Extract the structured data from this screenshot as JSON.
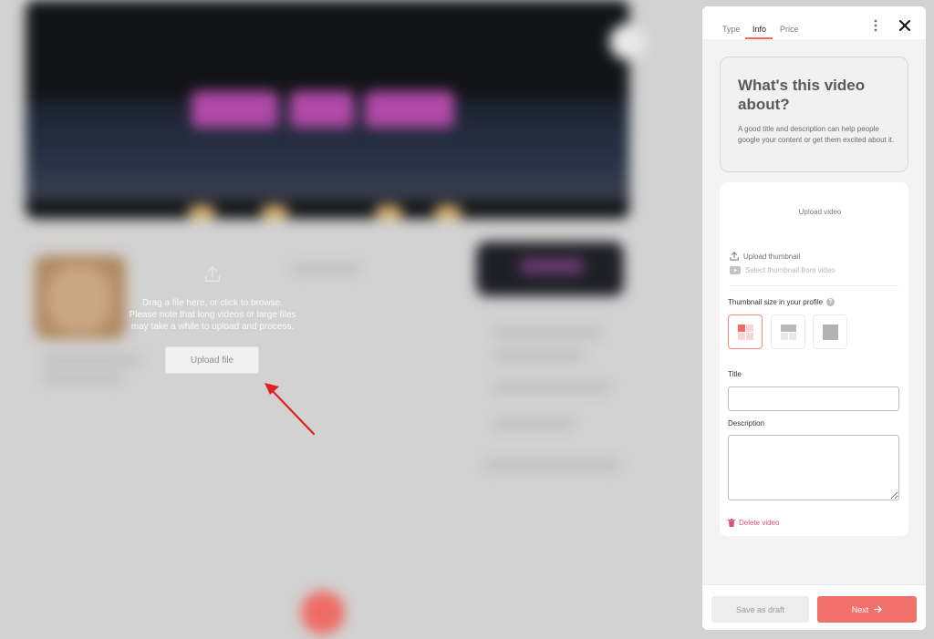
{
  "upload_area": {
    "instructions_line1": "Drag a file here, or click to browse.",
    "instructions_line2": "Please note that long videos or large files",
    "instructions_line3": "may take a while to upload and process.",
    "button_label": "Upload file"
  },
  "panel": {
    "tabs": [
      {
        "label": "Type",
        "active": false
      },
      {
        "label": "Info",
        "active": true
      },
      {
        "label": "Price",
        "active": false
      }
    ],
    "intro": {
      "title": "What's this video about?",
      "text": "A good title and description can help people google your content or get them excited about it."
    },
    "upload_video_label": "Upload video",
    "upload_thumbnail_label": "Upload thumbnail",
    "select_thumbnail_label": "Select thumbnail from video",
    "thumbnail_size_label": "Thumbnail size in your profile",
    "title_label": "Title",
    "title_value": "",
    "description_label": "Description",
    "description_value": "",
    "delete_label": "Delete video",
    "footer": {
      "draft_label": "Save as draft",
      "next_label": "Next"
    }
  },
  "colors": {
    "accent": "#f2706a",
    "delete": "#d94f76"
  },
  "icons": [
    "upload-cloud-icon",
    "more-vertical-icon",
    "close-icon",
    "upload-icon",
    "video-icon",
    "help-icon",
    "trash-icon",
    "arrow-right-icon"
  ]
}
